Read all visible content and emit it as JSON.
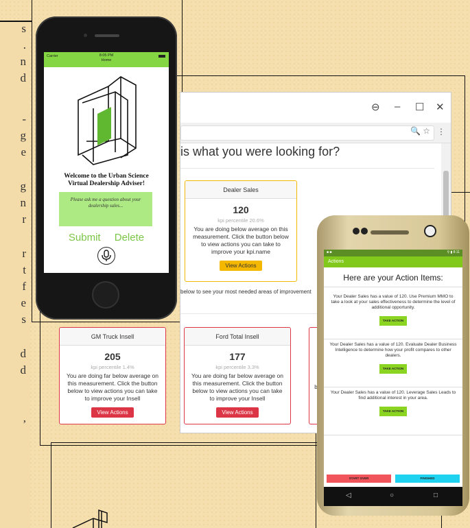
{
  "paper": {
    "left_margin_fragments": [
      "s",
      ".",
      "n",
      "d",
      "-",
      "g",
      "e",
      "g",
      "n",
      "r",
      "r",
      "t",
      "f",
      "e",
      "s",
      "d",
      "d",
      ","
    ]
  },
  "iphone": {
    "status": {
      "carrier": "Carrier",
      "time": "8:05 PM",
      "screen": "Home"
    },
    "welcome_line1": "Welcome to the Urban Science",
    "welcome_line2": "Virtual Dealership Adviser!",
    "placeholder": "Please ask me a question about your dealership sales...",
    "submit_label": "Submit",
    "delete_label": "Delete"
  },
  "browser": {
    "heading": "is what you were looking for?",
    "window_controls": {
      "account": "⊖",
      "minimize": "–",
      "maximize": "☐",
      "close": "✕"
    },
    "addr_icons": "🔍 ☆",
    "dealer_card": {
      "title": "Dealer Sales",
      "value": "120",
      "percentile": "kpi percentile 20.6%",
      "description": "You are doing below average on this measurement. Click the button below to view actions you can take to improve your kpi.name",
      "button": "View Actions"
    },
    "improve_note": "below to see your most needed areas of improvement",
    "insell_cards": [
      {
        "title": "GM Truck Insell",
        "value": "205",
        "percentile": "kpi percentile 1.4%",
        "description": "You are doing far below average on this measurement. Click the button below to view actions you can take to improve your Insell",
        "button": "View Actions"
      },
      {
        "title": "Ford Total Insell",
        "value": "177",
        "percentile": "kpi percentile 3.3%",
        "description": "You are doing far below average on this measurement. Click the button below to view actions you can take to improve your Insell",
        "button": "View Actions"
      }
    ],
    "partial_letter": "b"
  },
  "android": {
    "status_right": "⚲ ▮ 8:11",
    "app_bar": "Actions",
    "title": "Here are your Action Items:",
    "items": [
      {
        "text": "Your Dealer Sales has a value of 120. Use Premium MMO to take a look at your sales effectiveness to determine the level of additional opportunity.",
        "button": "TAKE ACTION"
      },
      {
        "text": "Your Dealer Sales has a value of 120. Evaluate Dealer Business Intelligence to determine how your profit compares to other dealers.",
        "button": "TAKE ACTION"
      },
      {
        "text": "Your Dealer Sales has a value of 120. Leverage Sales Leads to find additional interest in your area.",
        "button": "TAKE ACTION"
      }
    ],
    "start_over": "START OVER",
    "finished": "FINISHED",
    "nav": {
      "back": "◁",
      "home": "○",
      "recent": "□"
    }
  },
  "colors": {
    "brand_green": "#84d742",
    "warning_yellow": "#f5b800",
    "danger_red": "#dc3545",
    "android_green": "#81c91a",
    "finished_cyan": "#1fd3f0",
    "start_over_red": "#f2545b"
  }
}
